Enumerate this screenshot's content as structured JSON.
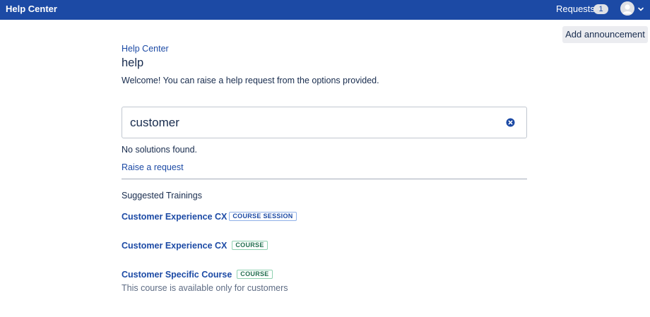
{
  "topbar": {
    "brand": "Help Center",
    "requests_label": "Requests",
    "requests_count": "1"
  },
  "announcement_button": "Add announcement",
  "breadcrumb": "Help Center",
  "page_title": "help",
  "welcome_text": "Welcome! You can raise a help request from the options provided.",
  "search": {
    "value": "customer"
  },
  "no_solutions": "No solutions found.",
  "raise_request": "Raise a request",
  "suggested_heading": "Suggested Trainings",
  "trainings": [
    {
      "title": "Customer Experience CX",
      "tag": "COURSE SESSION",
      "tag_color": "#1c4aa5"
    },
    {
      "title": "Customer Experience CX",
      "tag": "COURSE",
      "tag_color": "#216e4e"
    },
    {
      "title": "Customer Specific Course",
      "tag": "COURSE",
      "tag_color": "#216e4e",
      "description": "This course is available only for customers"
    }
  ],
  "icons": {
    "avatar": "user-avatar-icon",
    "chevron": "chevron-down-icon",
    "clear": "clear-search-icon"
  },
  "colors": {
    "topbar": "#1c4aa5",
    "link": "#1c4aa5",
    "text": "#172b4d",
    "muted": "#5e6c84"
  }
}
